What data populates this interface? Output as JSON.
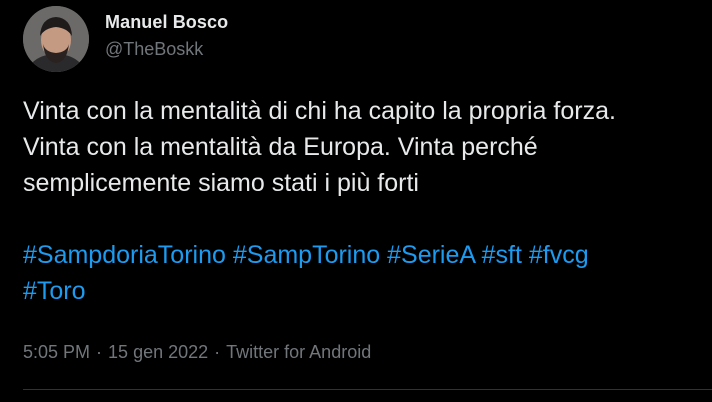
{
  "author": {
    "display_name": "Manuel Bosco",
    "handle": "@TheBoskk"
  },
  "tweet": {
    "lines": [
      "Vinta con la mentalità di chi ha capito la propria forza.",
      "Vinta con la mentalità da Europa. Vinta perché",
      "semplicemente siamo stati i più forti"
    ],
    "hashtags_line1": [
      "#SampdoriaTorino",
      "#SampTorino",
      "#SerieA",
      "#sft",
      "#fvcg"
    ],
    "hashtags_line2": [
      "#Toro"
    ]
  },
  "meta": {
    "time": "5:05 PM",
    "separator": "·",
    "date": "15 gen 2022",
    "source": "Twitter for Android"
  },
  "colors": {
    "background": "#000000",
    "text": "#e7e9ea",
    "secondary": "#71767b",
    "link": "#1d9bf0"
  }
}
